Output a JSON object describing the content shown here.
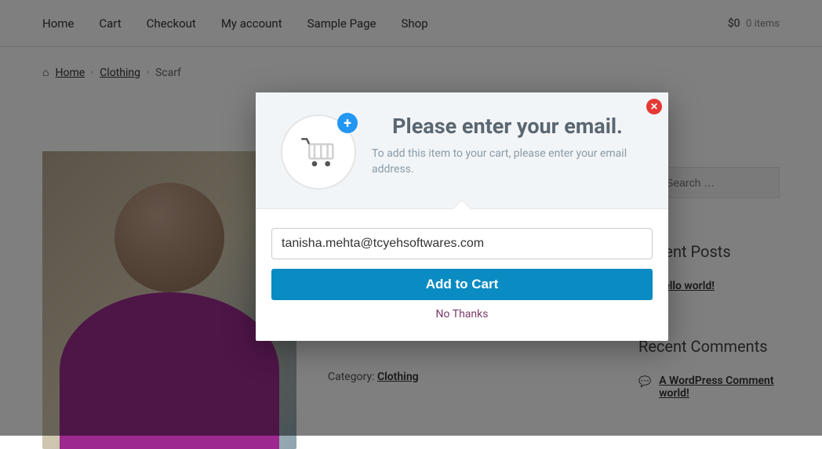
{
  "nav": {
    "items": [
      "Home",
      "Cart",
      "Checkout",
      "My account",
      "Sample Page",
      "Shop"
    ],
    "cart_amount": "$0",
    "cart_items": "0 items"
  },
  "breadcrumb": {
    "home": "Home",
    "category": "Clothing",
    "current": "Scarf"
  },
  "product": {
    "category_label": "Category:",
    "category_link": "Clothing"
  },
  "sidebar": {
    "search_placeholder": "Search …",
    "recent_posts_title": "Recent Posts",
    "post_link": "Hello world!",
    "recent_comments_title": "Recent Comments",
    "comment_preview_a": "A WordPress Comment",
    "comment_preview_b": "world!"
  },
  "modal": {
    "title": "Please enter your email.",
    "subtitle": "To add this item to your cart, please enter your email address.",
    "email_value": "tanisha.mehta@tcyehsoftwares.com",
    "add_button": "Add to Cart",
    "no_thanks": "No Thanks"
  }
}
